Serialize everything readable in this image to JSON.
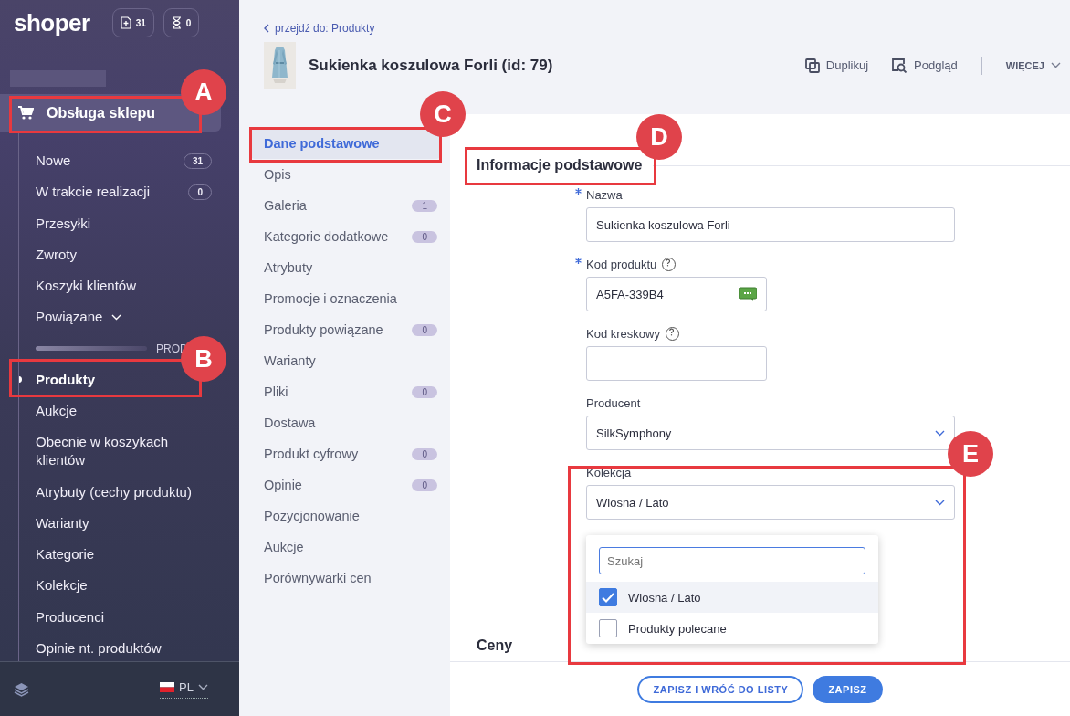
{
  "sidebar": {
    "logo": "shoper",
    "counters": [
      {
        "kind": "new",
        "count": "31"
      },
      {
        "kind": "pending",
        "count": "0"
      }
    ],
    "section": {
      "label": "Obsługa sklepu",
      "expanded": true
    },
    "items": [
      {
        "label": "Nowe",
        "badge": "31",
        "selected": false
      },
      {
        "label": "W trakcie realizacji",
        "badge": "0",
        "selected": false
      },
      {
        "label": "Przesyłki",
        "selected": false
      },
      {
        "label": "Zwroty",
        "selected": false
      },
      {
        "label": "Koszyki klientów",
        "selected": false
      },
      {
        "label": "Powiązane",
        "selected": false,
        "expanded": false,
        "kind": "toggle"
      },
      {
        "label": "PROD",
        "kind": "group"
      },
      {
        "label": "Produkty",
        "selected": true
      },
      {
        "label": "Aukcje",
        "selected": false
      },
      {
        "label": "Obecnie w koszykach klientów",
        "selected": false
      },
      {
        "label": "Atrybuty (cechy produktu)",
        "selected": false
      },
      {
        "label": "Warianty",
        "selected": false
      },
      {
        "label": "Kategorie",
        "selected": false
      },
      {
        "label": "Kolekcje",
        "selected": false
      },
      {
        "label": "Producenci",
        "selected": false
      },
      {
        "label": "Opinie nt. produktów",
        "selected": false
      }
    ],
    "language": "PL"
  },
  "header": {
    "back_link": "przejdź do: Produkty",
    "title": "Sukienka koszulowa Forli (id: 79)",
    "actions": [
      {
        "kind": "duplicate",
        "label": "Duplikuj"
      },
      {
        "kind": "preview",
        "label": "Podgląd"
      }
    ],
    "more": "WIĘCEJ"
  },
  "tabs": [
    {
      "label": "Dane podstawowe",
      "selected": true
    },
    {
      "label": "Opis",
      "selected": false
    },
    {
      "label": "Galeria",
      "badge": "1",
      "selected": false
    },
    {
      "label": "Kategorie dodatkowe",
      "badge": "0",
      "selected": false
    },
    {
      "label": "Atrybuty",
      "selected": false
    },
    {
      "label": "Promocje i oznaczenia",
      "selected": false
    },
    {
      "label": "Produkty powiązane",
      "badge": "0",
      "selected": false
    },
    {
      "label": "Warianty",
      "selected": false
    },
    {
      "label": "Pliki",
      "badge": "0",
      "selected": false
    },
    {
      "label": "Dostawa",
      "selected": false
    },
    {
      "label": "Produkt cyfrowy",
      "badge": "0",
      "selected": false
    },
    {
      "label": "Opinie",
      "badge": "0",
      "selected": false
    },
    {
      "label": "Pozycjonowanie",
      "selected": false
    },
    {
      "label": "Aukcje",
      "selected": false
    },
    {
      "label": "Porównywarki cen",
      "selected": false
    }
  ],
  "form": {
    "heading": "Informacje podstawowe",
    "fields": [
      {
        "kind": "text",
        "label": "Nazwa",
        "required": true,
        "value": "Sukienka koszulowa Forli"
      },
      {
        "kind": "code",
        "label": "Kod produktu",
        "required": true,
        "help": true,
        "value": "A5FA-339B4",
        "generator": true
      },
      {
        "kind": "code",
        "label": "Kod kreskowy",
        "required": false,
        "help": true
      },
      {
        "kind": "select",
        "label": "Producent",
        "required": false,
        "value": "SilkSymphony",
        "expanded": false
      },
      {
        "kind": "select",
        "label": "Kolekcja",
        "required": false,
        "value": "Wiosna / Lato",
        "expanded": true
      }
    ],
    "dropdown": {
      "placeholder": "Szukaj",
      "options": [
        {
          "label": "Wiosna / Lato",
          "checked": true
        },
        {
          "label": "Produkty polecane",
          "checked": false
        }
      ]
    },
    "next_heading": "Ceny"
  },
  "footer": {
    "buttons": [
      {
        "kind": "secondary",
        "label": "ZAPISZ I WRÓĆ DO LISTY"
      },
      {
        "kind": "primary",
        "label": "ZAPISZ"
      }
    ]
  },
  "callouts": [
    {
      "label": "A"
    },
    {
      "label": "B"
    },
    {
      "label": "C"
    },
    {
      "label": "D"
    },
    {
      "label": "E"
    }
  ]
}
